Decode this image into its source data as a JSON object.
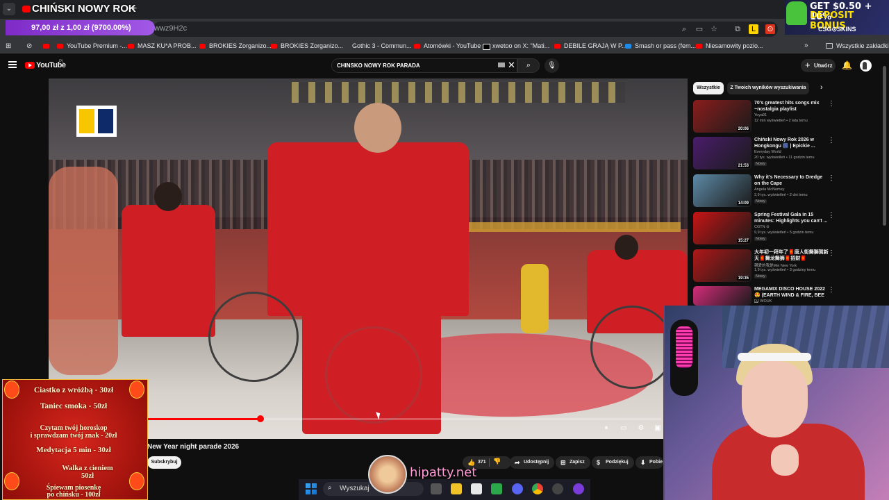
{
  "browser": {
    "active_tab_title": "CHIŃSKI NOWY ROK",
    "new_tab_symbol": "+",
    "url_fragment": "wwz9H2c",
    "promo_overlay": "97,00 zł z 1,00 zł (9700.00%)",
    "bookmarks": [
      "YouTube Premium -...",
      "MASZ KU*A PROB...",
      "BROKIES Zorganizo...",
      "BROKIES Zorganizo...",
      "Gothic 3 - Commun...",
      "Atomówki - YouTube",
      "xwetoo on X: \"Mati...",
      "DEBILE GRAJĄ W P...",
      "Smash or pass (fem...",
      "Niesamowity pozio..."
    ],
    "all_bookmarks_label": "Wszystkie zakładki",
    "ad": {
      "line1": "GET $0.50 + 10%",
      "line2": "DEPOSIT BONUS",
      "logo": "CSG⊙SKINS"
    }
  },
  "youtube": {
    "logo_text": "YouTube",
    "region": "PL",
    "search_query": "CHINSKO NOWY ROK PARADA",
    "create_label": "Utwórz",
    "video": {
      "title": "New Year night parade 2026",
      "progress_fraction": 0.22,
      "subscribe_label": "Subskrybuj",
      "likes": "371",
      "share_label": "Udostępnij",
      "save_label": "Zapisz",
      "thanks_label": "Podziękuj",
      "download_label": "Pobie"
    },
    "chips": [
      "Wszystkie",
      "Z Twoich wyników wyszukiwania"
    ],
    "recommendations": [
      {
        "title": "70's greatest hits songs mix ~nostalgia playlist",
        "channel": "Yoya91",
        "meta": "12 mln wyświetleń • 2 lata temu",
        "duration": "20:06",
        "badge": "",
        "color": "#8b1d1d"
      },
      {
        "title": "Chiński Nowy Rok 2026 w Hongkongu 🎆 | Epickie ...",
        "channel": "Everyday World",
        "meta": "20 tys. wyświetleń • 11 godzin temu",
        "duration": "21:53",
        "badge": "Nowy",
        "color": "#4a1d6b"
      },
      {
        "title": "Why it's Necessary to Dredge on the Cape",
        "channel": "Angela McNemey",
        "meta": "2,9 tys. wyświetleń • 2 dni temu",
        "duration": "14:09",
        "badge": "Nowy",
        "color": "#5d8aa6"
      },
      {
        "title": "Spring Festival Gala in 15 minutes: Highlights you can't ...",
        "channel": "CGTN ⊘",
        "meta": "9,9 tys. wyświetleń • 5 godzin temu",
        "duration": "15:27",
        "badge": "Nowy",
        "color": "#c81414"
      },
      {
        "title": "大年初一拜年了🧧唐人街舞獅賀新天🧧舞龙舞狮🧧招财🧧",
        "channel": "親愛的我是Mei New York",
        "meta": "1,9 tys. wyświetleń • 3 godziny temu",
        "duration": "19:35",
        "badge": "Nowy",
        "color": "#b01818"
      },
      {
        "title": "MEGAMIX DISCO HOUSE 2022 😍 (EARTH WIND & FIRE, BEE ...",
        "channel": "DJ WOUK",
        "meta": "",
        "duration": "",
        "badge": "",
        "color": "#d42c7a"
      }
    ]
  },
  "stream_overlay": {
    "menu": [
      "Ciastko z wróżbą - 30zł",
      "Taniec smoka - 50zł",
      "Czytam twój horoskop",
      "i sprawdzam twój znak - 20zł",
      "Medytacja 5 min - 30zł",
      "Walka z cieniem",
      "50zł",
      "Śpiewam piosenkę",
      "po chińsku - 100zł"
    ],
    "watermark": "hipatty.net"
  },
  "taskbar": {
    "search_label": "Wyszukaj"
  }
}
